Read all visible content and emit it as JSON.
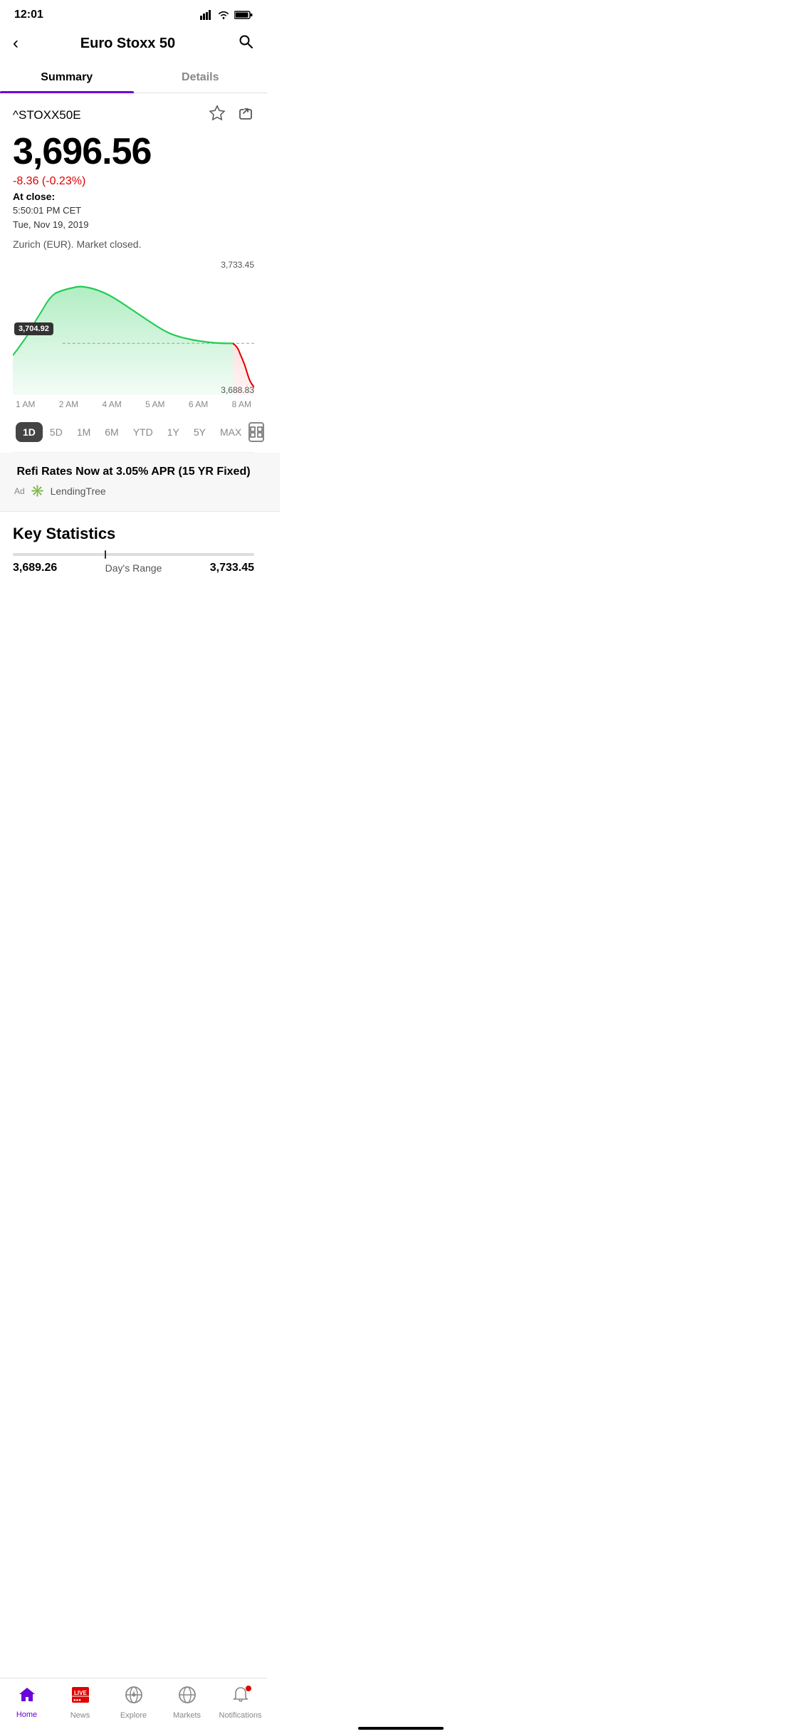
{
  "statusBar": {
    "time": "12:01",
    "signal": "▂▄▆█",
    "wifi": "wifi",
    "battery": "battery"
  },
  "header": {
    "title": "Euro Stoxx 50",
    "backLabel": "←",
    "searchLabel": "🔍"
  },
  "tabs": [
    {
      "label": "Summary",
      "active": true
    },
    {
      "label": "Details",
      "active": false
    }
  ],
  "stock": {
    "ticker": "^STOXX50E",
    "price": "3,696.56",
    "change": "-8.36 (-0.23%)",
    "closeLabel": "At close:",
    "closeTime": "5:50:01 PM CET",
    "closeDate": "Tue, Nov 19, 2019",
    "marketStatus": "Zurich (EUR). Market closed.",
    "openingPrice": "3,704.92",
    "chartHigh": "3,733.45",
    "chartLow": "3,688.83"
  },
  "timeAxis": [
    "1 AM",
    "2 AM",
    "4 AM",
    "5 AM",
    "6 AM",
    "8 AM"
  ],
  "periods": [
    {
      "label": "1D",
      "active": true
    },
    {
      "label": "5D",
      "active": false
    },
    {
      "label": "1M",
      "active": false
    },
    {
      "label": "6M",
      "active": false
    },
    {
      "label": "YTD",
      "active": false
    },
    {
      "label": "1Y",
      "active": false
    },
    {
      "label": "5Y",
      "active": false
    },
    {
      "label": "MAX",
      "active": false
    }
  ],
  "ad": {
    "title": "Refi Rates Now at 3.05% APR (15 YR Fixed)",
    "badge": "Ad",
    "brand": "LendingTree"
  },
  "keyStats": {
    "title": "Key Statistics",
    "rangeLow": "3,689.26",
    "rangeLabel": "Day's Range",
    "rangeHigh": "3,733.45"
  },
  "nav": [
    {
      "label": "Home",
      "icon": "home",
      "active": true
    },
    {
      "label": "News",
      "icon": "live-news",
      "active": false
    },
    {
      "label": "Explore",
      "icon": "explore",
      "active": false
    },
    {
      "label": "Markets",
      "icon": "markets",
      "active": false
    },
    {
      "label": "Notifications",
      "icon": "notifications",
      "active": false,
      "badge": true
    }
  ]
}
